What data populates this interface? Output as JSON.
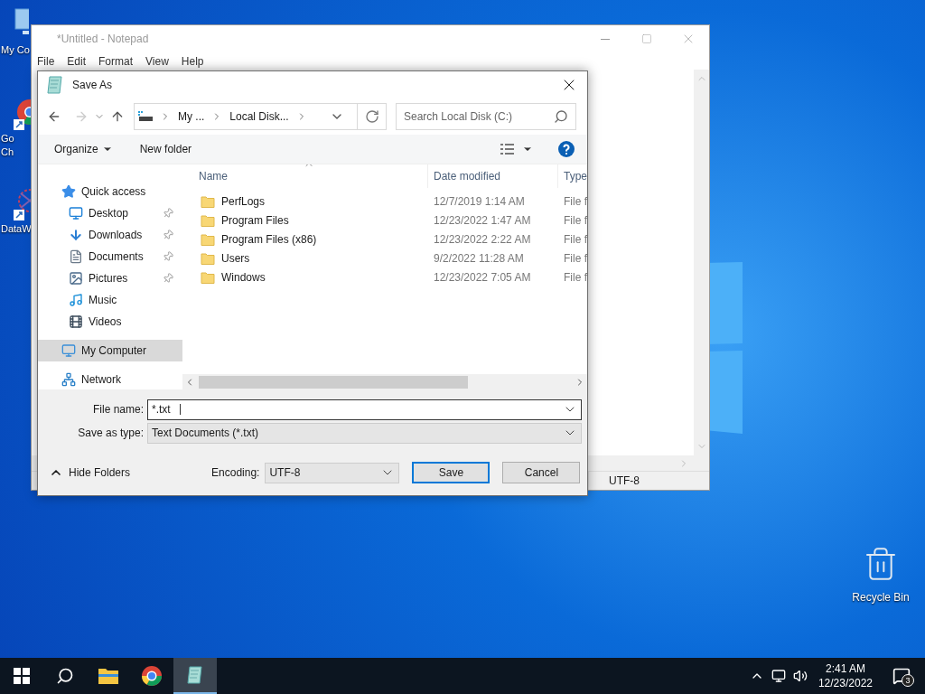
{
  "desktop_icons": [
    {
      "kind": "computer",
      "label_lines": [
        "My Co"
      ]
    },
    {
      "kind": "browser",
      "label_lines": [
        "Go",
        "Ch"
      ]
    },
    {
      "kind": "app",
      "label_lines": [
        "DataW"
      ]
    }
  ],
  "recycle_bin": {
    "label": "Recycle Bin"
  },
  "notepad": {
    "title": "*Untitled - Notepad",
    "menu": [
      "File",
      "Edit",
      "Format",
      "View",
      "Help"
    ],
    "status_bar": {
      "encoding": "UTF-8"
    }
  },
  "dialog": {
    "title": "Save As",
    "breadcrumb": [
      "My ...",
      "Local Disk..."
    ],
    "search": {
      "placeholder": "Search Local Disk (C:)"
    },
    "toolbar": {
      "organize": "Organize",
      "new_folder": "New folder"
    },
    "nav": [
      {
        "label": "Quick access",
        "kind": "star",
        "pinned": false,
        "selected": false,
        "children": [
          {
            "label": "Desktop",
            "kind": "desktop",
            "pinned": true,
            "selected": false
          },
          {
            "label": "Downloads",
            "kind": "download",
            "pinned": true,
            "selected": false
          },
          {
            "label": "Documents",
            "kind": "document",
            "pinned": true,
            "selected": false
          },
          {
            "label": "Pictures",
            "kind": "pictures",
            "pinned": true,
            "selected": false
          },
          {
            "label": "Music",
            "kind": "music",
            "pinned": false,
            "selected": false
          },
          {
            "label": "Videos",
            "kind": "videos",
            "pinned": false,
            "selected": false
          }
        ]
      },
      {
        "label": "My Computer",
        "kind": "computer",
        "pinned": false,
        "selected": true
      },
      {
        "label": "Network",
        "kind": "network",
        "pinned": false,
        "selected": false
      }
    ],
    "columns": [
      "Name",
      "Date modified",
      "Type"
    ],
    "rows": [
      {
        "name": "PerfLogs",
        "date": "12/7/2019 1:14 AM",
        "type": "File f"
      },
      {
        "name": "Program Files",
        "date": "12/23/2022 1:47 AM",
        "type": "File f"
      },
      {
        "name": "Program Files (x86)",
        "date": "12/23/2022 2:22 AM",
        "type": "File f"
      },
      {
        "name": "Users",
        "date": "9/2/2022 11:28 AM",
        "type": "File f"
      },
      {
        "name": "Windows",
        "date": "12/23/2022 7:05 AM",
        "type": "File f"
      }
    ],
    "file_name": {
      "label": "File name:",
      "value": "*.txt"
    },
    "save_as_type": {
      "label": "Save as type:",
      "value": "Text Documents (*.txt)"
    },
    "hide_folders": "Hide Folders",
    "encoding": {
      "label": "Encoding:",
      "value": "UTF-8"
    },
    "buttons": [
      {
        "label": "Save",
        "default": true
      },
      {
        "label": "Cancel",
        "default": false
      }
    ]
  },
  "taskbar": {
    "apps": [
      {
        "kind": "start",
        "active": false
      },
      {
        "kind": "search",
        "active": false
      },
      {
        "kind": "folder",
        "active": false
      },
      {
        "kind": "browser",
        "active": false
      },
      {
        "kind": "notepad",
        "active": true
      }
    ],
    "clock": {
      "time": "2:41 AM",
      "date": "12/23/2022"
    },
    "notifications": "3"
  }
}
